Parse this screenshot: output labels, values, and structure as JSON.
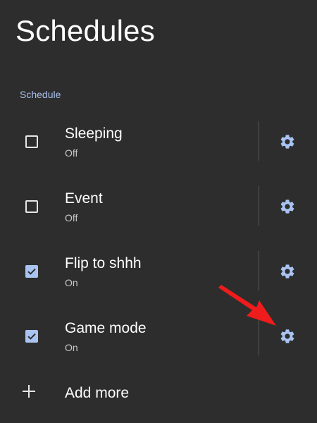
{
  "header": {
    "title": "Schedules"
  },
  "section": {
    "label": "Schedule"
  },
  "schedules": [
    {
      "title": "Sleeping",
      "status": "Off",
      "checked": false
    },
    {
      "title": "Event",
      "status": "Off",
      "checked": false
    },
    {
      "title": "Flip to shhh",
      "status": "On",
      "checked": true
    },
    {
      "title": "Game mode",
      "status": "On",
      "checked": true
    }
  ],
  "add_more": {
    "label": "Add more"
  },
  "icons": {
    "settings": "gear-icon",
    "add": "plus-icon",
    "annotation": "red-arrow-pointer"
  },
  "colors": {
    "background": "#2d2d2d",
    "accent": "#aac4f2",
    "annotation_arrow": "#ee1c1c"
  }
}
